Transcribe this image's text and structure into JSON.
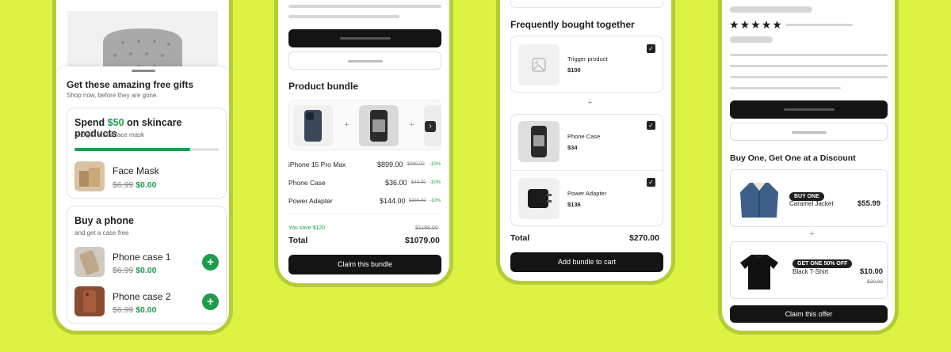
{
  "colors": {
    "background": "#dcf343",
    "frame": "#b6cc34",
    "accent_green": "#1f9b4c",
    "dark": "#141414"
  },
  "phone1": {
    "sheet_title": "Get these amazing free gifts",
    "sheet_subtitle": "Shop now, before they are gone.",
    "offer1": {
      "title_pre": "Spend ",
      "title_amount": "$50",
      "title_post": " on skincare products",
      "subtitle": "and get a free face mask",
      "progress": 0.8,
      "item": {
        "name": "Face Mask",
        "old_price": "$6.99",
        "new_price": "$0.00"
      }
    },
    "offer2": {
      "title": "Buy a phone",
      "subtitle": "and get a case free",
      "items": [
        {
          "name": "Phone case 1",
          "old_price": "$6.99",
          "new_price": "$0.00",
          "icon": "plus-icon"
        },
        {
          "name": "Phone case 2",
          "old_price": "$6.99",
          "new_price": "$0.00",
          "icon": "plus-icon"
        }
      ]
    }
  },
  "phone2": {
    "title": "Product bundle",
    "rows": [
      {
        "name": "iPhone 15 Pro Max",
        "price": "$899.00",
        "old": "$990.00",
        "pct": "-10%"
      },
      {
        "name": "Phone Case",
        "price": "$36.00",
        "old": "$40.00",
        "pct": "-10%"
      },
      {
        "name": "Power Adapter",
        "price": "$144.00",
        "old": "$160.00",
        "pct": "-10%"
      }
    ],
    "save_text": "You save $120",
    "save_old": "$1199.00",
    "total_label": "Total",
    "total_value": "$1079.00",
    "cta": "Claim this bundle"
  },
  "phone3": {
    "title": "Frequently bought together",
    "items": [
      {
        "name": "Trigger product",
        "price": "$100"
      },
      {
        "name": "Phone Case",
        "price": "$34"
      },
      {
        "name": "Power Adapter",
        "price": "$136"
      }
    ],
    "total_label": "Total",
    "total_value": "$270.00",
    "cta": "Add bundle to cart"
  },
  "phone4": {
    "rating_stars": 5,
    "title": "Buy One, Get One at a Discount",
    "item1": {
      "tag": "BUY ONE",
      "name": "Caramel Jacket",
      "price": "$55.99"
    },
    "item2": {
      "tag": "GET ONE 50% OFF",
      "name": "Black T-Shirt",
      "price": "$10.00",
      "old_price": "$20.00"
    },
    "cta": "Claim this offer"
  }
}
